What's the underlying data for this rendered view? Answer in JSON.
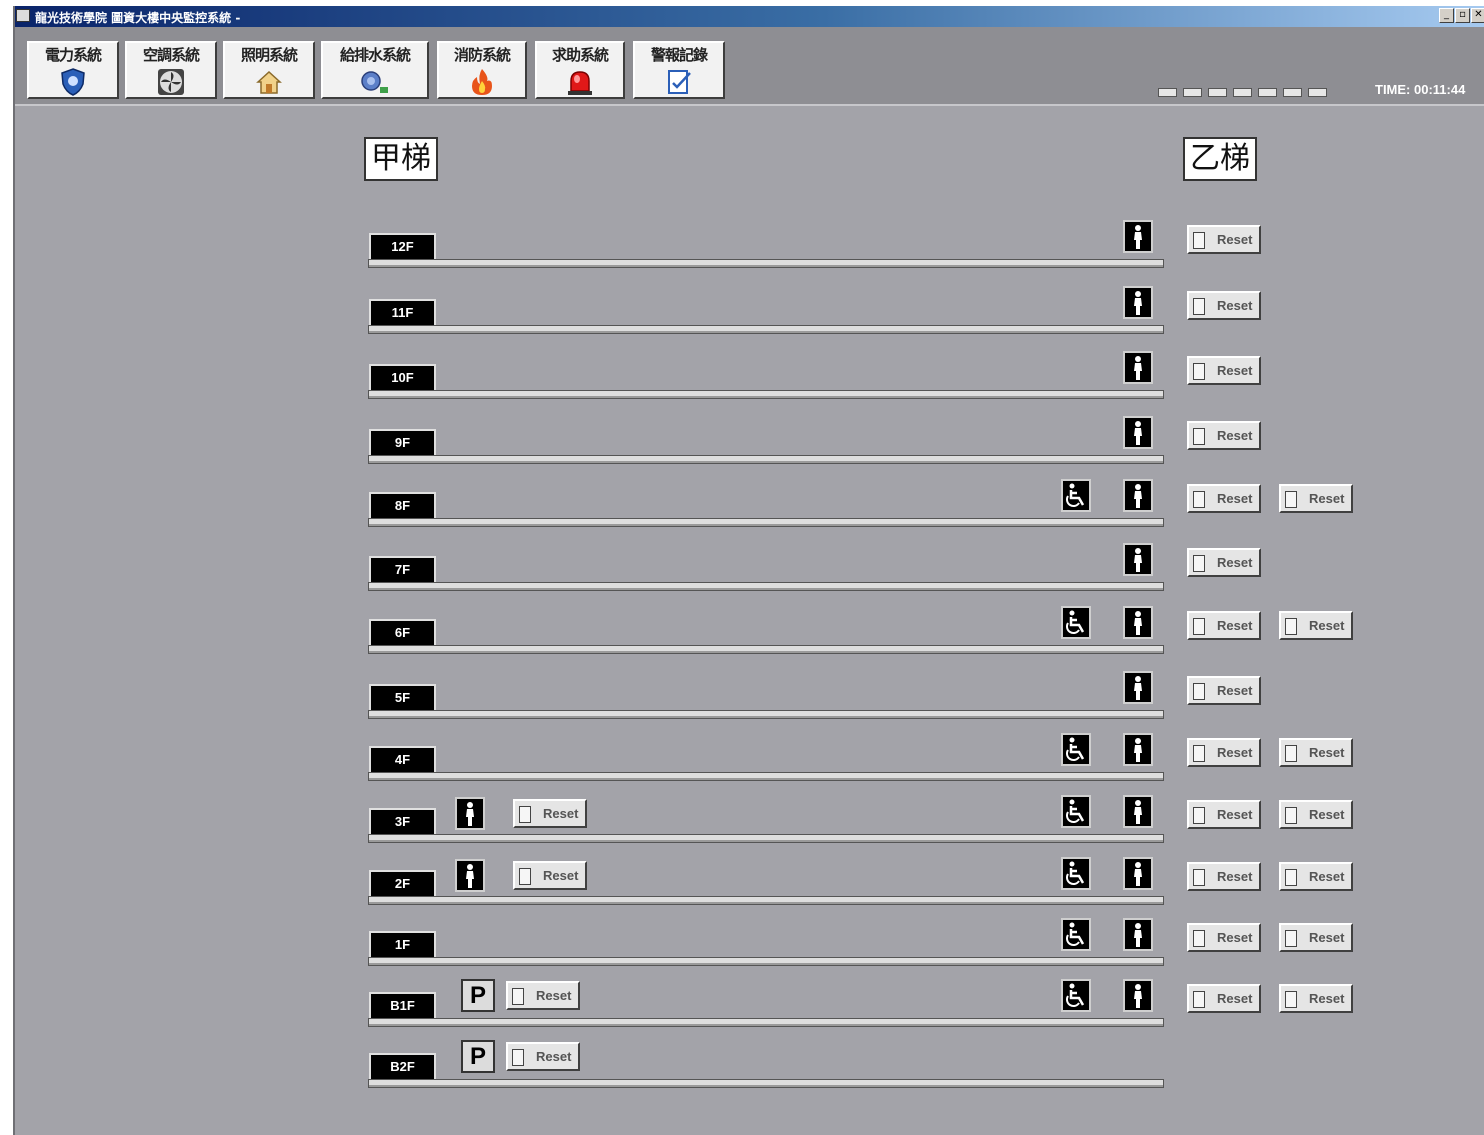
{
  "window": {
    "title": "龍光技術學院 圖資大樓中央監控系統 -",
    "controls": [
      "_",
      "▫",
      "✕"
    ]
  },
  "toolbar": {
    "systems": [
      {
        "label": "電力系統",
        "icon": "shield-icon"
      },
      {
        "label": "空調系統",
        "icon": "fan-icon"
      },
      {
        "label": "照明系統",
        "icon": "house-light-icon"
      },
      {
        "label": "給排水系統",
        "icon": "water-pump-icon"
      },
      {
        "label": "消防系統",
        "icon": "fire-icon"
      },
      {
        "label": "求助系統",
        "icon": "alarm-light-icon"
      },
      {
        "label": "警報記錄",
        "icon": "log-icon"
      }
    ],
    "status_leds": 7,
    "clock": "TIME: 00:11:44"
  },
  "elevators": {
    "a_label": "甲梯",
    "b_label": "乙梯"
  },
  "reset_label": "Reset",
  "floors": [
    {
      "name": "12F",
      "left": [],
      "accessible": false,
      "person": true,
      "resets": 1
    },
    {
      "name": "11F",
      "left": [],
      "accessible": false,
      "person": true,
      "resets": 1
    },
    {
      "name": "10F",
      "left": [],
      "accessible": false,
      "person": true,
      "resets": 1
    },
    {
      "name": "9F",
      "left": [],
      "accessible": false,
      "person": true,
      "resets": 1
    },
    {
      "name": "8F",
      "left": [],
      "accessible": true,
      "person": true,
      "resets": 2
    },
    {
      "name": "7F",
      "left": [],
      "accessible": false,
      "person": true,
      "resets": 1
    },
    {
      "name": "6F",
      "left": [],
      "accessible": true,
      "person": true,
      "resets": 2
    },
    {
      "name": "5F",
      "left": [],
      "accessible": false,
      "person": true,
      "resets": 1
    },
    {
      "name": "4F",
      "left": [],
      "accessible": true,
      "person": true,
      "resets": 2
    },
    {
      "name": "3F",
      "left": [
        "person"
      ],
      "accessible": true,
      "person": true,
      "resets": 2
    },
    {
      "name": "2F",
      "left": [
        "person"
      ],
      "accessible": true,
      "person": true,
      "resets": 2
    },
    {
      "name": "1F",
      "left": [],
      "accessible": true,
      "person": true,
      "resets": 2
    },
    {
      "name": "B1F",
      "left": [
        "parking"
      ],
      "accessible": true,
      "person": true,
      "resets": 2
    },
    {
      "name": "B2F",
      "left": [
        "parking"
      ],
      "accessible": false,
      "person": false,
      "resets": 0
    }
  ],
  "parking_label": "P",
  "colors": {
    "panel": "#a3a3a9",
    "toolbar": "#8e8e93",
    "floor_tag": "#000000"
  }
}
